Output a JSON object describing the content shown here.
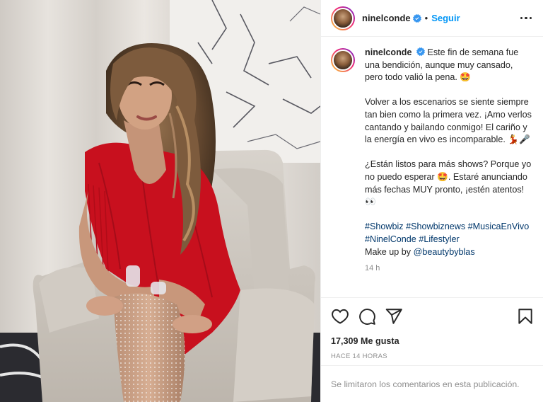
{
  "post": {
    "username": "ninelconde",
    "follow_label": "Seguir",
    "separator": "•",
    "caption": {
      "paragraphs": [
        "Este fin de semana fue una bendición, aunque muy cansado, pero todo valió la pena. 🤩",
        "Volver a los escenarios se siente siempre tan bien como la primera vez. ¡Amo verlos cantando y bailando conmigo! El cariño y la energía en vivo es incomparable. 💃🎤",
        "¿Están listos para más shows? Porque yo no puedo esperar 🤩. Estaré anunciando más fechas MUY pronto, ¡estén atentos! 👀"
      ],
      "hashtags": [
        "#Showbiz",
        "#Showbiznews",
        "#MusicaEnVivo",
        "#NinelConde",
        "#Lifestyler"
      ],
      "credit_prefix": "Make up by",
      "credit_mention": "@beautybyblas"
    },
    "time_ago": "14 h",
    "likes_count": "17,309",
    "likes_label": "Me gusta",
    "date_label": "HACE 14 HORAS",
    "comments_disabled": "Se limitaron los comentarios en esta publicación."
  },
  "icons": {
    "verified": "verified-badge-icon",
    "more": "more-options-icon",
    "like": "heart-icon",
    "comment": "comment-icon",
    "share": "paper-plane-icon",
    "save": "bookmark-icon"
  },
  "colors": {
    "accent": "#0095f6",
    "link": "#00376b",
    "muted": "#8e8e8e",
    "text": "#262626",
    "dress": "#c8101e"
  }
}
